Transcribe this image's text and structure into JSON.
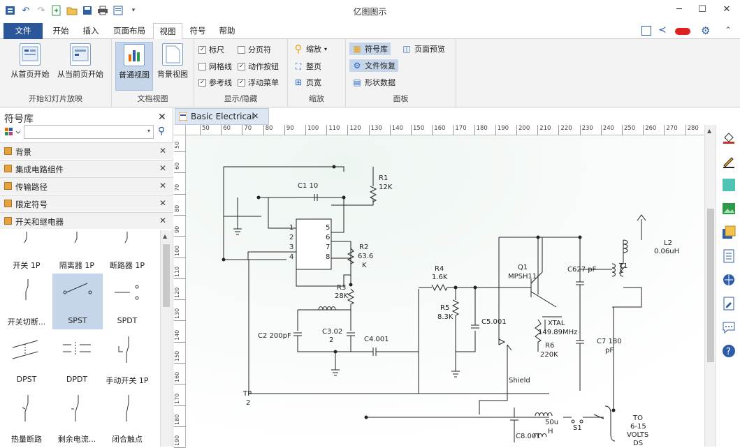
{
  "app": {
    "title": "亿图图示"
  },
  "menu": {
    "file": "文件",
    "home": "开始",
    "insert": "插入",
    "page_layout": "页面布局",
    "view": "视图",
    "symbol": "符号",
    "help": "帮助"
  },
  "ribbon": {
    "slideshow": {
      "from_first": "从首页开始",
      "from_current": "从当前页开始",
      "label": "开始幻灯片放映"
    },
    "docview": {
      "normal": "普通视图",
      "background": "背景视图",
      "label": "文档视图"
    },
    "showhide": {
      "ruler": "标尺",
      "page_break": "分页符",
      "grid": "网格线",
      "action_button": "动作按钮",
      "guide": "参考线",
      "float_menu": "浮动菜单",
      "label": "显示/隐藏"
    },
    "zoom": {
      "zoom": "缩放",
      "whole_page": "整页",
      "page_width": "页宽",
      "label": "缩放"
    },
    "panel": {
      "library": "符号库",
      "recovery": "文件恢复",
      "page_preview": "页面预览",
      "shape_data": "形状数据",
      "label": "面板"
    }
  },
  "library": {
    "title": "符号库",
    "categories": [
      "背景",
      "集成电路组件",
      "传输路径",
      "限定符号",
      "开关和继电器"
    ],
    "shapes": [
      "开关 1P",
      "隔离器 1P",
      "断路器 1P",
      "开关切断...",
      "SPST",
      "SPDT",
      "DPST",
      "DPDT",
      "手动开关 1P",
      "热量断路",
      "剩余电流...",
      "闭合触点"
    ]
  },
  "document": {
    "tab": "Basic Electrical"
  },
  "ruler": {
    "h": [
      "50",
      "60",
      "70",
      "80",
      "90",
      "100",
      "110",
      "120",
      "130",
      "140",
      "150",
      "160",
      "170",
      "180",
      "190",
      "200",
      "210",
      "220",
      "230",
      "240",
      "250",
      "260",
      "270",
      "280"
    ],
    "v": [
      "50",
      "60",
      "70",
      "80",
      "90",
      "100",
      "110",
      "120",
      "130",
      "140",
      "150",
      "160",
      "170",
      "180",
      "190"
    ]
  },
  "circuit": {
    "labels": {
      "c1": "C1 10",
      "r1": "R1",
      "r1v": "12K",
      "r2": "R2",
      "r2v": "63.6",
      "r2u": "K",
      "r3": "R3",
      "r3v": "28K",
      "c2": "C2 200pF",
      "c3": "C3.02",
      "c3v": "2",
      "c4": "C4.001",
      "tp": "TP",
      "tpv": "2",
      "r4": "R4",
      "r4v": "1.6K",
      "r5": "R5",
      "r5v": "8.3K",
      "c5": "C5.001",
      "q1": "Q1",
      "q1v": "MPSH11",
      "xtal": "XTAL",
      "xtalv": "149.89MHz",
      "r6": "R6",
      "r6v": "220K",
      "shield": "Shield",
      "c6": "C627 pF",
      "t1": "T1",
      "c7": "C7 180",
      "c7u": "pF",
      "l2": "L2",
      "l2v": "0.06uH",
      "l3": "50u",
      "l3u": "H",
      "s1": "S1",
      "c8": "C8.001",
      "to": "TO",
      "tov": "6-15",
      "volts": "VOLTS",
      "ds": "DS",
      "p1": "1",
      "p2": "2",
      "p3": "3",
      "p4": "4",
      "p5": "5",
      "p6": "6",
      "p7": "7",
      "p8": "8"
    }
  }
}
